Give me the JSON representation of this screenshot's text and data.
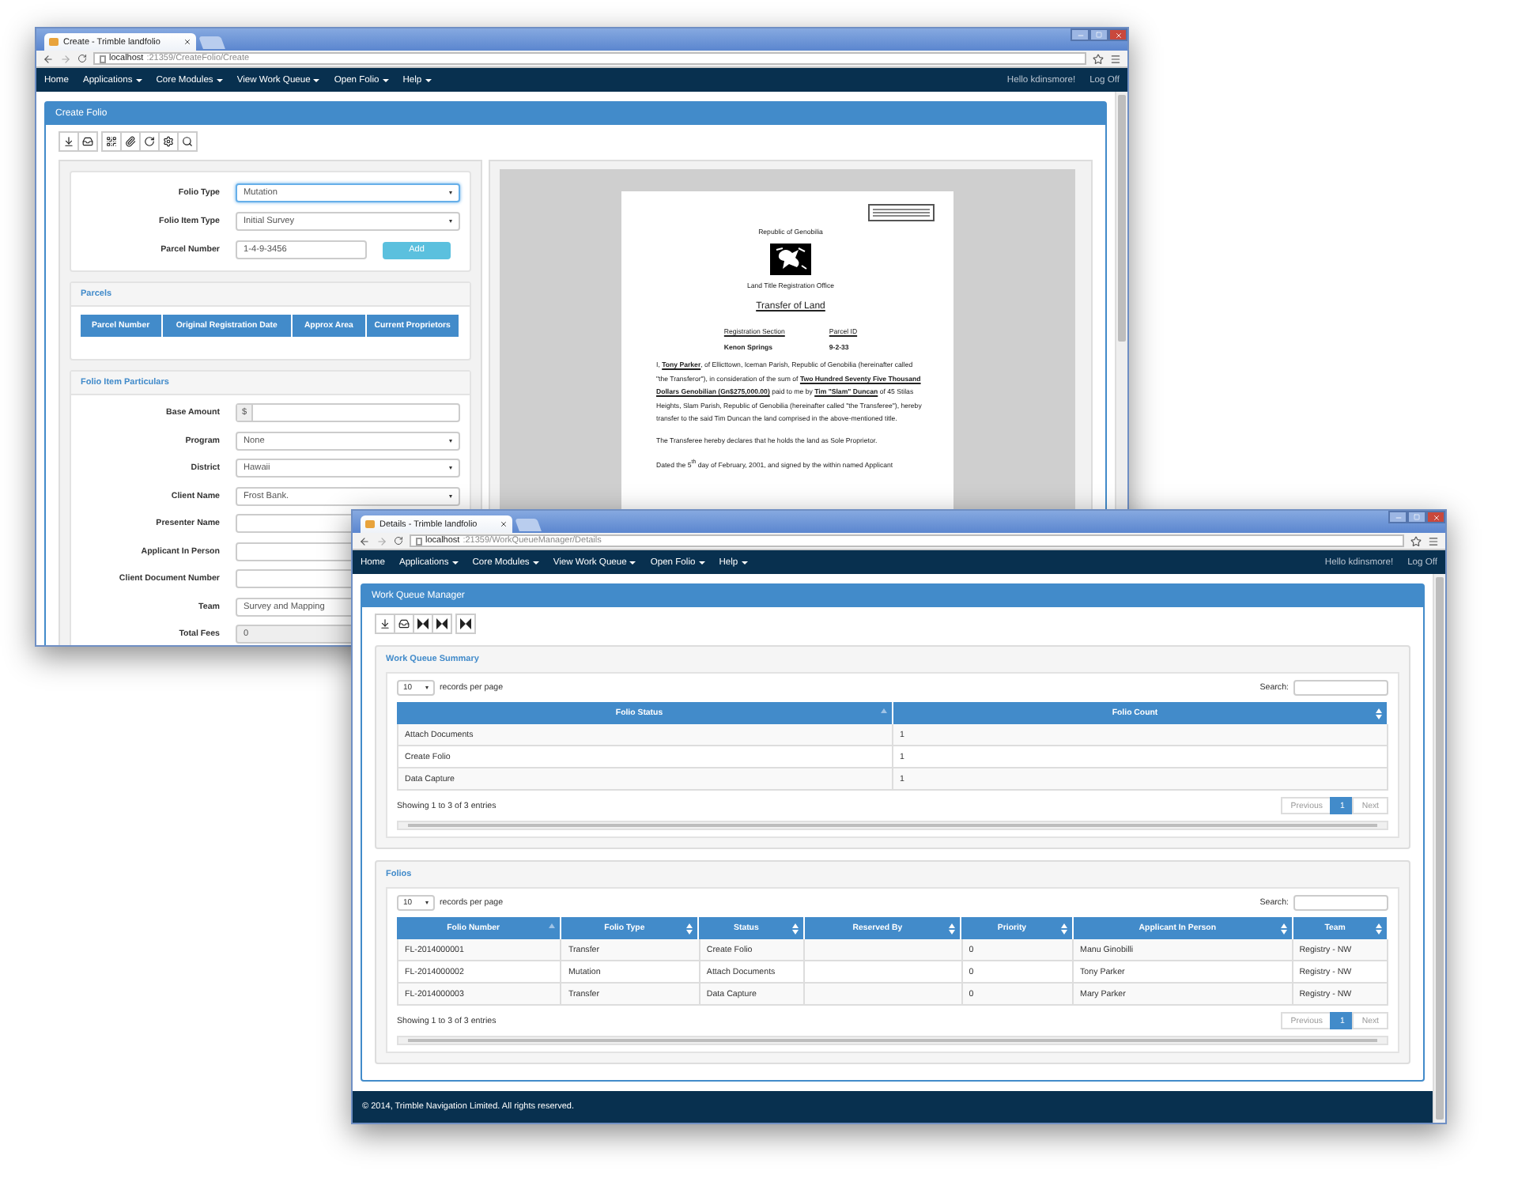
{
  "back_window": {
    "tab_title": "Create - Trimble landfolio",
    "url_host": "localhost",
    "url_path": ":21359/CreateFolio/Create",
    "nav": [
      {
        "label": "Home",
        "dropdown": false
      },
      {
        "label": "Applications",
        "dropdown": true
      },
      {
        "label": "Core Modules",
        "dropdown": true
      },
      {
        "label": "View Work Queue",
        "dropdown": true
      },
      {
        "label": "Open Folio",
        "dropdown": true
      },
      {
        "label": "Help",
        "dropdown": true
      }
    ],
    "greeting": "Hello kdinsmore!",
    "log_off": "Log Off",
    "panel_title": "Create Folio",
    "form": [
      {
        "label": "Folio Type",
        "kind": "select",
        "value": "Mutation",
        "focused": true
      },
      {
        "label": "Folio Item Type",
        "kind": "select",
        "value": "Initial Survey",
        "focused": false
      },
      {
        "label": "Parcel Number",
        "kind": "input",
        "value": "1-4-9-3456",
        "button": "Add",
        "focused": false
      }
    ],
    "parcels": {
      "title": "Parcels",
      "columns": [
        "Parcel Number",
        "Original Registration Date",
        "Approx Area",
        "Current Proprietors"
      ]
    },
    "particulars": {
      "title": "Folio Item Particulars",
      "fields": [
        {
          "label": "Base Amount",
          "kind": "addon",
          "addon": "$"
        },
        {
          "label": "Program",
          "kind": "select",
          "value": "None"
        },
        {
          "label": "District",
          "kind": "select",
          "value": "Hawaii"
        },
        {
          "label": "Client Name",
          "kind": "select",
          "value": "Frost Bank."
        },
        {
          "label": "Presenter Name",
          "kind": "input"
        },
        {
          "label": "Applicant In Person",
          "kind": "input"
        },
        {
          "label": "Client Document Number",
          "kind": "input"
        },
        {
          "label": "Team",
          "kind": "select",
          "value": "Survey and Mapping"
        },
        {
          "label": "Total Fees",
          "kind": "readonly",
          "value": "0"
        }
      ]
    },
    "document": {
      "header": "Republic of Genobilia",
      "office": "Land Title Registration Office",
      "title": "Transfer of Land",
      "columns": [
        {
          "heading": "Registration Section",
          "value": "Kenon Springs"
        },
        {
          "heading": "Parcel ID",
          "value": "9-2-33"
        }
      ],
      "paragraphs": [
        "I, **Tony Parker**, of Ellicttown, Iceman Parish, Republic of Genobilia (hereinafter called \"the Transferor\"), in consideration of the sum of **Two Hundred Seventy Five Thousand Dollars Genobilian (Gn$275,000.00)** paid to me by **Tim \"Slam\" Duncan** of 45 Stilas Heights, Slam Parish, Republic of Genobilia (hereinafter called \"the Transferee\"), hereby transfer to the said Tim Duncan the land comprised in the above-mentioned title.",
        "The Transferee hereby declares that he holds the land as Sole Proprietor.",
        "Dated the 5$^{th}$ day of February, 2001, and signed by the within named Applicant"
      ]
    }
  },
  "front_window": {
    "tab_title": "Details - Trimble landfolio",
    "url_host": "localhost",
    "url_path": ":21359/WorkQueueManager/Details",
    "nav": [
      {
        "label": "Home",
        "dropdown": false
      },
      {
        "label": "Applications",
        "dropdown": true
      },
      {
        "label": "Core Modules",
        "dropdown": true
      },
      {
        "label": "View Work Queue",
        "dropdown": true
      },
      {
        "label": "Open Folio",
        "dropdown": true
      },
      {
        "label": "Help",
        "dropdown": true
      }
    ],
    "greeting": "Hello kdinsmore!",
    "log_off": "Log Off",
    "panel_title": "Work Queue Manager",
    "sections": [
      {
        "title": "Work Queue Summary",
        "page_size": "10",
        "length_label": "records per page",
        "search_label": "Search:",
        "columns": [
          {
            "label": "Folio Status",
            "sorted": true
          },
          {
            "label": "Folio Count",
            "sorted": false
          }
        ],
        "rows": [
          [
            "Attach Documents",
            "1"
          ],
          [
            "Create Folio",
            "1"
          ],
          [
            "Data Capture",
            "1"
          ]
        ],
        "info": "Showing 1 to 3 of 3 entries",
        "pagination": [
          {
            "label": "Previous",
            "selected": false,
            "disabled": true
          },
          {
            "label": "1",
            "selected": true,
            "disabled": false
          },
          {
            "label": "Next",
            "selected": false,
            "disabled": true
          }
        ]
      },
      {
        "title": "Folios",
        "page_size": "10",
        "length_label": "records per page",
        "search_label": "Search:",
        "columns": [
          {
            "label": "Folio Number",
            "sorted": true
          },
          {
            "label": "Folio Type",
            "sorted": false
          },
          {
            "label": "Status",
            "sorted": false
          },
          {
            "label": "Reserved By",
            "sorted": false
          },
          {
            "label": "Priority",
            "sorted": false
          },
          {
            "label": "Applicant In Person",
            "sorted": false
          },
          {
            "label": "Team",
            "sorted": false
          }
        ],
        "rows": [
          [
            "FL-2014000001",
            "Transfer",
            "Create Folio",
            "",
            "0",
            "Manu Ginobilli",
            "Registry - NW"
          ],
          [
            "FL-2014000002",
            "Mutation",
            "Attach Documents",
            "",
            "0",
            "Tony Parker",
            "Registry - NW"
          ],
          [
            "FL-2014000003",
            "Transfer",
            "Data Capture",
            "",
            "0",
            "Mary Parker",
            "Registry - NW"
          ]
        ],
        "info": "Showing 1 to 3 of 3 entries",
        "pagination": [
          {
            "label": "Previous",
            "selected": false,
            "disabled": true
          },
          {
            "label": "1",
            "selected": true,
            "disabled": false
          },
          {
            "label": "Next",
            "selected": false,
            "disabled": true
          }
        ]
      }
    ],
    "footer": "© 2014, Trimble Navigation Limited. All rights reserved."
  }
}
